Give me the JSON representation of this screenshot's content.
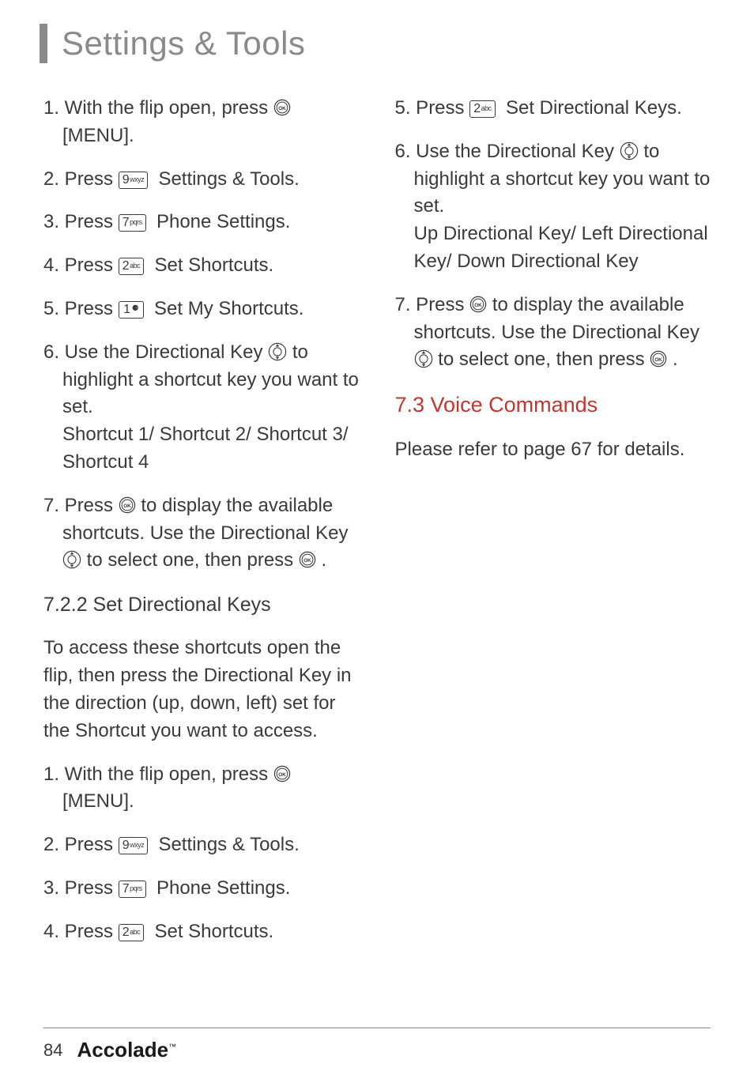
{
  "header": {
    "title": "Settings & Tools"
  },
  "left": {
    "s1": {
      "pre": "1. With the flip open, press ",
      "post": "[MENU]."
    },
    "s2": {
      "pre": "2. Press ",
      "label": "Settings & Tools."
    },
    "s3": {
      "pre": "3. Press ",
      "label": "Phone Settings."
    },
    "s4": {
      "pre": "4. Press ",
      "label": "Set Shortcuts."
    },
    "s5": {
      "pre": "5. Press ",
      "label": "Set My Shortcuts."
    },
    "s6": {
      "line1a": "6. Use the Directional Key ",
      "line1b": " to",
      "line2": "highlight a shortcut key you want to set.",
      "bold": "Shortcut 1/ Shortcut 2/ Shortcut 3/ Shortcut 4"
    },
    "s7": {
      "a": "7. Press ",
      "b": " to display the available shortcuts. Use the Directional Key ",
      "c": " to select one, then press ",
      "d": " ."
    },
    "subhead": "7.2.2 Set Directional Keys",
    "para": "To access these shortcuts open the flip, then press the Directional Key in the direction (up, down, left) set for the Shortcut you want to access.",
    "b1": {
      "pre": "1. With the flip open, press ",
      "post": "[MENU]."
    },
    "b2": {
      "pre": "2. Press ",
      "label": "Settings & Tools."
    },
    "b3": {
      "pre": "3. Press ",
      "label": "Phone Settings."
    },
    "b4": {
      "pre": "4. Press ",
      "label": "Set Shortcuts."
    }
  },
  "right": {
    "s5": {
      "pre": "5. Press ",
      "label": "Set Directional Keys."
    },
    "s6": {
      "line1a": "6. Use the Directional Key ",
      "line1b": " to",
      "line2": "highlight a shortcut key you want to set.",
      "bold": "Up Directional Key/ Left Directional Key/ Down Directional Key"
    },
    "s7": {
      "a": "7. Press ",
      "b": " to display the available shortcuts. Use the Directional Key ",
      "c": " to select one, then press ",
      "d": " ."
    },
    "section": "7.3 Voice Commands",
    "para": "Please refer to page 67 for details."
  },
  "keys": {
    "k9": {
      "num": "9",
      "sup": "wxyz"
    },
    "k7": {
      "num": "7",
      "sup": "pqrs"
    },
    "k2": {
      "num": "2",
      "sup": "abc"
    },
    "k1": {
      "num": "1",
      "sup": ""
    }
  },
  "footer": {
    "page": "84",
    "brand": "Accolade"
  }
}
